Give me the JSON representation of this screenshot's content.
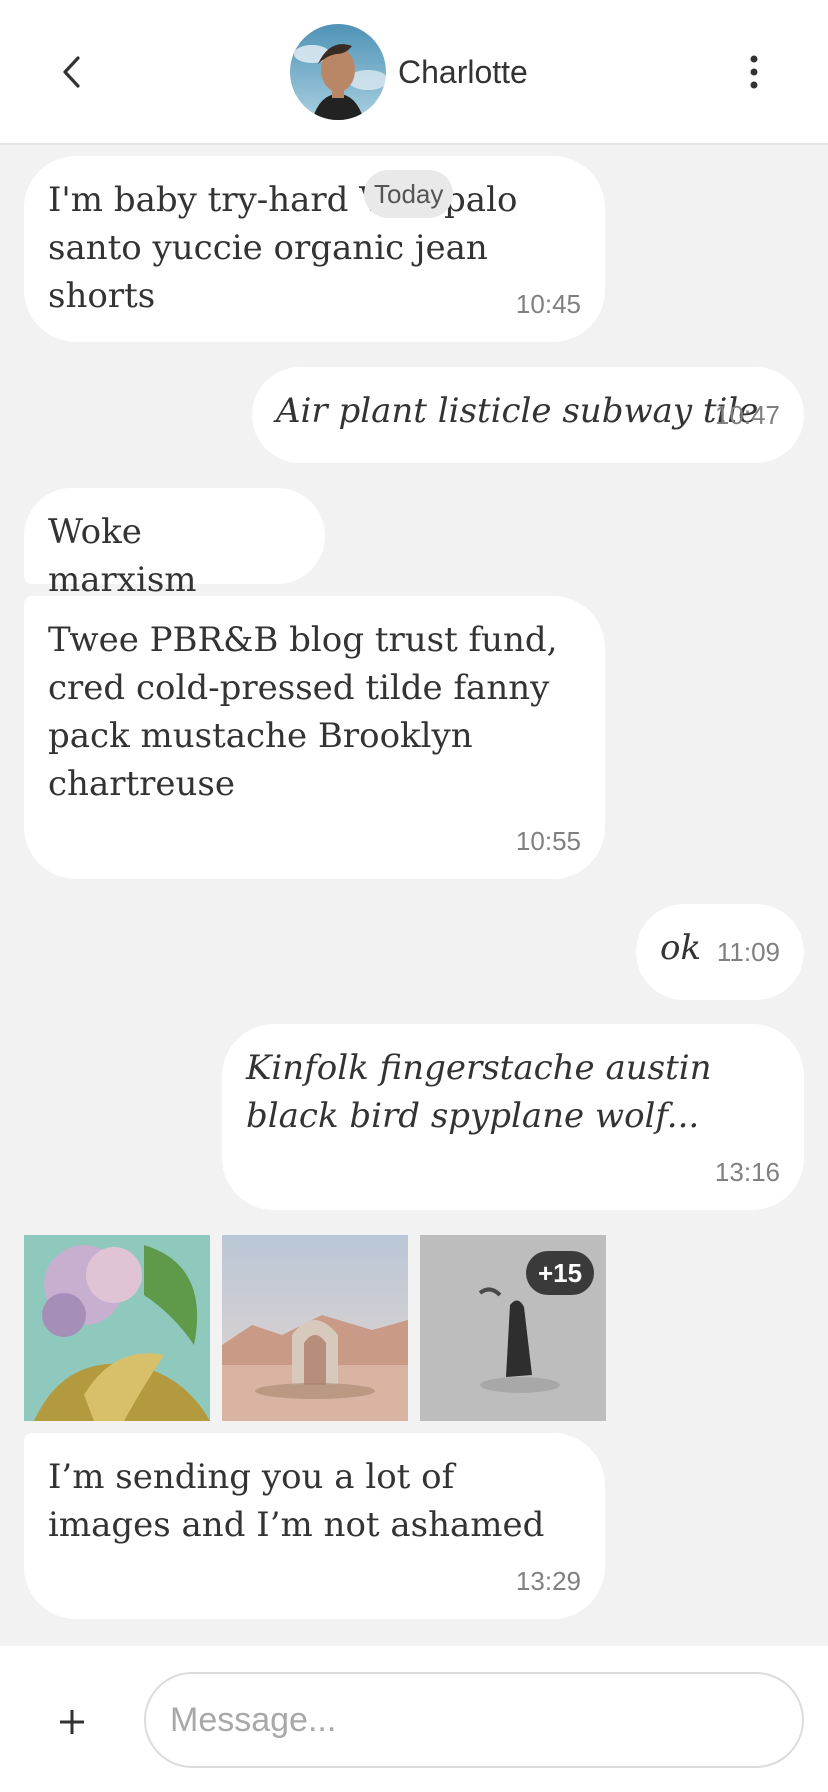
{
  "header": {
    "contact_name": "Charlotte"
  },
  "date_divider": "Today",
  "messages": [
    {
      "dir": "in",
      "text": "I'm baby try-hard Vice palo santo yuccie organic jean shorts",
      "time": "10:45"
    },
    {
      "dir": "out",
      "text": "Air plant listicle subway tile",
      "time": "10:47"
    },
    {
      "dir": "in",
      "text": "Woke marxism",
      "time": ""
    },
    {
      "dir": "in",
      "text": "Twee PBR&B blog trust fund, cred cold-pressed tilde fanny pack mustache Brooklyn chartreuse",
      "time": "10:55"
    },
    {
      "dir": "out",
      "text": "ok",
      "time": "11:09"
    },
    {
      "dir": "out",
      "text": "Kinfolk fingerstache austin black bird spyplane wolf...",
      "time": "13:16"
    },
    {
      "dir": "in",
      "text": "I’m sending you a lot of images and I’m not ashamed",
      "time": "13:29"
    }
  ],
  "images": {
    "more_count": "+15"
  },
  "composer": {
    "placeholder": "Message..."
  },
  "icons": {
    "back": "chevron-left-icon",
    "menu": "more-vertical-icon",
    "add": "plus-icon"
  },
  "colors": {
    "background": "#f2f2f2",
    "bubble": "#ffffff",
    "timestamp": "#808080"
  }
}
